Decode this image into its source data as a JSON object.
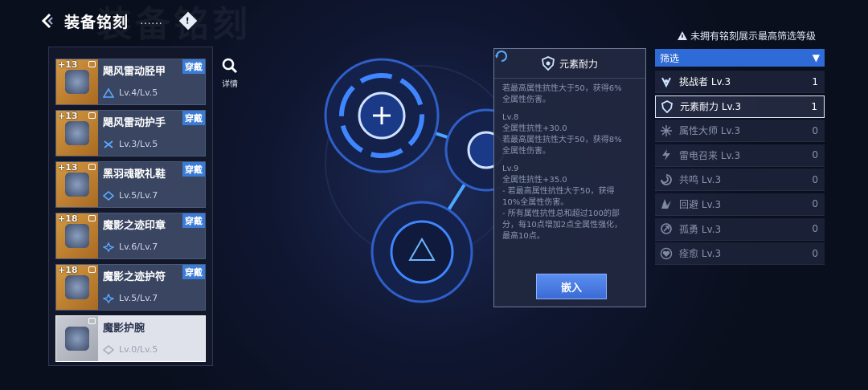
{
  "header": {
    "title": "装备铭刻",
    "dots": "……",
    "info": "!"
  },
  "detail_label": "详情",
  "equipment": [
    {
      "name": "飓风雷动胫甲",
      "plus": "+13",
      "level": "Lv.4/Lv.5",
      "badge": "穿戴"
    },
    {
      "name": "飓风雷动护手",
      "plus": "+13",
      "level": "Lv.3/Lv.5",
      "badge": "穿戴"
    },
    {
      "name": "黑羽魂歌礼鞋",
      "plus": "+13",
      "level": "Lv.5/Lv.7",
      "badge": "穿戴"
    },
    {
      "name": "魔影之迹印章",
      "plus": "+18",
      "level": "Lv.6/Lv.7",
      "badge": "穿戴"
    },
    {
      "name": "魔影之迹护符",
      "plus": "+18",
      "level": "Lv.5/Lv.7",
      "badge": "穿戴"
    },
    {
      "name": "魔影护腕",
      "plus": "",
      "level": "Lv.0/Lv.5",
      "badge": ""
    }
  ],
  "tooltip": {
    "title": "元素耐力",
    "top_fragment": "若最高属性抗性大于50，获得6%\n全属性伤害。",
    "lv8_label": "Lv.8",
    "lv8_text": "全属性抗性+30.0\n若最高属性抗性大于50，获得8%\n全属性伤害。",
    "lv9_label": "Lv.9",
    "lv9_text": "全属性抗性+35.0\n- 若最高属性抗性大于50，获得\n10%全属性伤害。\n- 所有属性抗性总和超过100的部\n分，每10点增加2点全属性强化，\n最高10点。",
    "embed_button": "嵌入"
  },
  "notice": "未拥有铭刻展示最高筛选等级",
  "filter": {
    "label": "筛选",
    "arrow": "▼"
  },
  "filters": [
    {
      "name": "挑战者 Lv.3",
      "count": "1",
      "icon": "challenger-icon"
    },
    {
      "name": "元素耐力 Lv.3",
      "count": "1",
      "icon": "shield-icon"
    },
    {
      "name": "属性大师 Lv.3",
      "count": "0",
      "icon": "star-icon"
    },
    {
      "name": "雷电召来 Lv.3",
      "count": "0",
      "icon": "lightning-icon"
    },
    {
      "name": "共鸣 Lv.3",
      "count": "0",
      "icon": "swirl-icon"
    },
    {
      "name": "回避 Lv.3",
      "count": "0",
      "icon": "wing-icon"
    },
    {
      "name": "孤勇 Lv.3",
      "count": "0",
      "icon": "arrow-icon"
    },
    {
      "name": "痊愈 Lv.3",
      "count": "0",
      "icon": "heart-icon"
    }
  ],
  "colors": {
    "accent": "#2f6bd6",
    "badge": "#3a7bd5",
    "thumb_gold": "#d49a42",
    "glow": "#4aa8ff"
  }
}
